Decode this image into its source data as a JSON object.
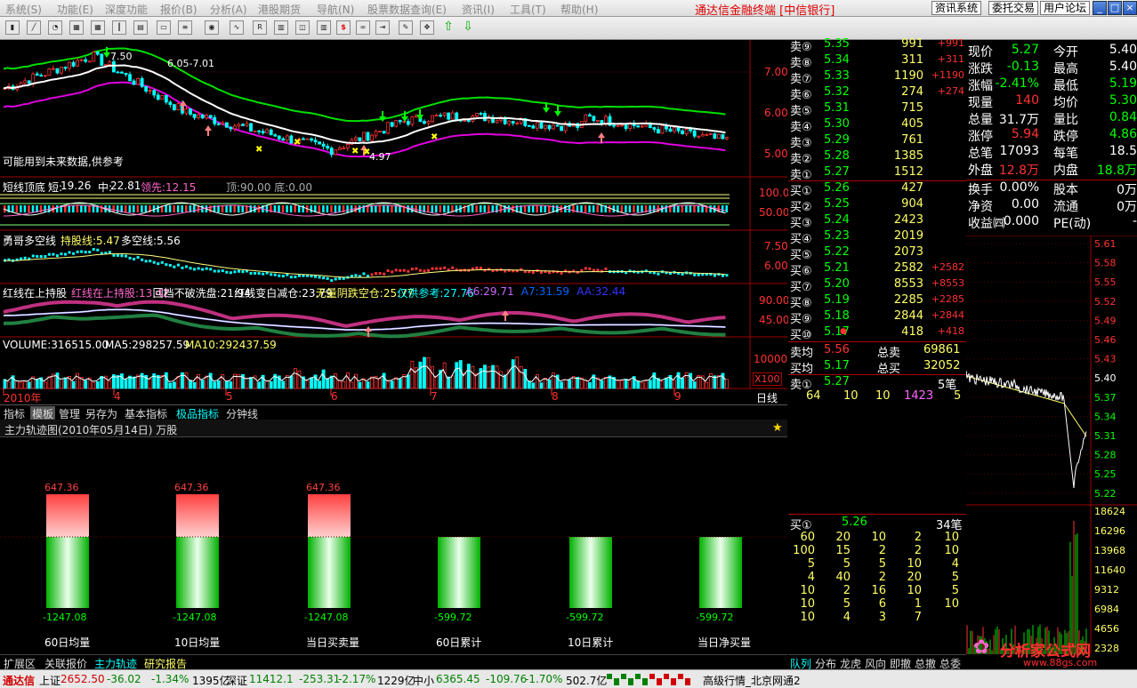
{
  "menu": [
    "系统(S)",
    "功能(E)",
    "深度功能",
    "报价(B)",
    "分析(A)",
    "港股期货",
    "导航(N)",
    "股票数据查询(E)",
    "资讯(I)",
    "工具(T)",
    "帮助(H)"
  ],
  "brand": "通达信金融终端 [中信银行]",
  "top_buttons": [
    "资讯系统",
    "委托交易",
    "用户论坛"
  ],
  "window_controls": [
    "_",
    "□",
    "×"
  ],
  "toolbar_icons": [
    "bar-chart-icon",
    "line-chart-icon",
    "pie-icon",
    "grid-icon",
    "grid-icon",
    "candle-icon",
    "table-icon",
    "doc-icon",
    "list-icon",
    "eye-icon",
    "trend-icon",
    "rsi-icon",
    "chart-icon",
    "orders-icon",
    "chart-icon",
    "dollar-icon",
    "link-icon",
    "export-icon",
    "pen-icon",
    "move-icon",
    "up-arrow-icon",
    "down-arrow-icon"
  ],
  "colors": {
    "up": "#ff3232",
    "down": "#00ffff",
    "green": "#00e000",
    "white": "#ffffff",
    "yellow": "#ffff00",
    "magenta": "#ff00ff",
    "label": "#c0c0c0"
  },
  "chart": {
    "hi_label": "7.50",
    "range_label": "6.05-7.01",
    "low_label": "4.97",
    "future_note": "可能用到未来数据,供参考",
    "price_axis": [
      "7.00",
      "6.00",
      "5.00"
    ],
    "osc_title": "短线顶底",
    "osc_params": [
      {
        "k": "短:",
        "v": "19.26"
      },
      {
        "k": "中:",
        "v": "22.81"
      }
    ],
    "osc_lead": "领先:12.15",
    "osc_extra": "顶:90.00 底:0.00",
    "osc_axis": [
      "100.0",
      "50.00"
    ],
    "bb_title": "勇哥多空线",
    "bb_hold": "持股线:5.47",
    "bb_ls": "多空线:5.56",
    "bb_axis": [
      "7.50",
      "6.00"
    ],
    "red_title": "红线在上持股",
    "red_params": [
      {
        "t": "红线在上持股:13.42",
        "c": "#ff66cc"
      },
      {
        "t": "回档不破洗盘:21.94",
        "c": "#ffffff"
      },
      {
        "t": "红线变白减仓:23.79",
        "c": "#ffffff"
      },
      {
        "t": "无量阴跌空仓:25.77",
        "c": "#ffff66"
      },
      {
        "t": "仅供参考:27.76",
        "c": "#00ffff"
      },
      {
        "t": "A6:29.71",
        "c": "#cc66ff"
      },
      {
        "t": "A7:31.59",
        "c": "#0066ff"
      },
      {
        "t": "AA:32.44",
        "c": "#3333ff"
      }
    ],
    "red_axis": [
      "90.00",
      "45.00"
    ],
    "vol_title": "VOLUME:316515.00",
    "vol_ma5": "MA5:298257.59",
    "vol_ma10": "MA10:292437.59",
    "vol_axis": [
      "10000"
    ],
    "vol_unit": "X100",
    "x_labels": [
      "2010年",
      "4",
      "5",
      "6",
      "7",
      "8",
      "9"
    ],
    "period": "日线"
  },
  "bottom_tabs": [
    "指标",
    "模板",
    "管理",
    "另存为",
    "基本指标",
    "极品指标",
    "分钟线"
  ],
  "f10": {
    "title": "主力轨迹图(2010年05月14日) 万股",
    "star_icon": "star-icon"
  },
  "bars": {
    "values": [
      647.36,
      647.36,
      647.36,
      -1247.08,
      -1247.08,
      -1247.08,
      -599.72,
      -599.72,
      -599.72
    ],
    "items": [
      {
        "label": "60日均量",
        "top": "647.36",
        "bottom": "-1247.08",
        "pos_value": 647.36,
        "neg_value": -1247.08,
        "has_red": true
      },
      {
        "label": "10日均量",
        "top": "647.36",
        "bottom": "-1247.08",
        "pos_value": 647.36,
        "neg_value": -1247.08,
        "has_red": true
      },
      {
        "label": "当日买卖量",
        "top": "647.36",
        "bottom": "-1247.08",
        "pos_value": 647.36,
        "neg_value": -1247.08,
        "has_red": true
      },
      {
        "label": "60日累计",
        "top": "",
        "bottom": "-599.72",
        "pos_value": 0,
        "neg_value": -599.72,
        "has_red": false
      },
      {
        "label": "10日累计",
        "top": "",
        "bottom": "-599.72",
        "pos_value": 0,
        "neg_value": -599.72,
        "has_red": false
      },
      {
        "label": "当日净买量",
        "top": "",
        "bottom": "-599.72",
        "pos_value": 0,
        "neg_value": -599.72,
        "has_red": false
      }
    ]
  },
  "orderbook": {
    "sells": [
      {
        "label": "卖⑨",
        "price": "5.35",
        "vol": "991",
        "chg": "+991"
      },
      {
        "label": "卖⑧",
        "price": "5.34",
        "vol": "311",
        "chg": "+311"
      },
      {
        "label": "卖⑦",
        "price": "5.33",
        "vol": "1190",
        "chg": "+1190"
      },
      {
        "label": "卖⑥",
        "price": "5.32",
        "vol": "274",
        "chg": "+274"
      },
      {
        "label": "卖⑤",
        "price": "5.31",
        "vol": "715",
        "chg": ""
      },
      {
        "label": "卖④",
        "price": "5.30",
        "vol": "405",
        "chg": ""
      },
      {
        "label": "卖③",
        "price": "5.29",
        "vol": "761",
        "chg": ""
      },
      {
        "label": "卖②",
        "price": "5.28",
        "vol": "1385",
        "chg": ""
      },
      {
        "label": "卖①",
        "price": "5.27",
        "vol": "1512",
        "chg": ""
      }
    ],
    "buys": [
      {
        "label": "买①",
        "price": "5.26",
        "vol": "427",
        "chg": ""
      },
      {
        "label": "买②",
        "price": "5.25",
        "vol": "904",
        "chg": ""
      },
      {
        "label": "买③",
        "price": "5.24",
        "vol": "2423",
        "chg": ""
      },
      {
        "label": "买④",
        "price": "5.23",
        "vol": "2019",
        "chg": ""
      },
      {
        "label": "买⑤",
        "price": "5.22",
        "vol": "2073",
        "chg": ""
      },
      {
        "label": "买⑥",
        "price": "5.21",
        "vol": "2582",
        "chg": "+2582"
      },
      {
        "label": "买⑦",
        "price": "5.20",
        "vol": "8553",
        "chg": "+8553"
      },
      {
        "label": "买⑧",
        "price": "5.19",
        "vol": "2285",
        "chg": "+2285"
      },
      {
        "label": "买⑨",
        "price": "5.18",
        "vol": "2844",
        "chg": "+2844"
      },
      {
        "label": "买⑩",
        "price": "5.17",
        "vol": "418",
        "chg": "+418"
      }
    ],
    "sell_avg_label": "卖均",
    "sell_avg": "5.56",
    "total_sell_label": "总卖",
    "total_sell": "69861",
    "buy_avg_label": "买均",
    "buy_avg": "5.17",
    "total_buy_label": "总买",
    "total_buy": "32052",
    "sell1_label": "卖①",
    "sell1_price": "5.27",
    "sell1_count": "5笔",
    "sell1_queue": [
      "64",
      "10",
      "10",
      "1423",
      "5"
    ]
  },
  "quote": {
    "rows": [
      {
        "k1": "现价",
        "v1": "5.27",
        "c1": "#00ff00",
        "k2": "今开",
        "v2": "5.40",
        "c2": "#ffffff"
      },
      {
        "k1": "涨跌",
        "v1": "-0.13",
        "c1": "#00ff00",
        "k2": "最高",
        "v2": "5.40",
        "c2": "#ffffff"
      },
      {
        "k1": "涨幅",
        "v1": "-2.41%",
        "c1": "#00ff00",
        "k2": "最低",
        "v2": "5.19",
        "c2": "#00ff00"
      },
      {
        "k1": "现量",
        "v1": "140",
        "c1": "#ff3232",
        "k2": "均价",
        "v2": "5.30",
        "c2": "#00ff00"
      },
      {
        "k1": "总量",
        "v1": "31.7万",
        "c1": "#ffffff",
        "k2": "量比",
        "v2": "0.84",
        "c2": "#00ff00"
      },
      {
        "k1": "涨停",
        "v1": "5.94",
        "c1": "#ff3232",
        "k2": "跌停",
        "v2": "4.86",
        "c2": "#00ff00"
      },
      {
        "k1": "总笔",
        "v1": "17093",
        "c1": "#ffffff",
        "k2": "每笔",
        "v2": "18.5",
        "c2": "#ffffff"
      },
      {
        "k1": "外盘",
        "v1": "12.8万",
        "c1": "#ff3232",
        "k2": "内盘",
        "v2": "18.8万",
        "c2": "#00ff00"
      }
    ],
    "rows2": [
      {
        "k1": "换手",
        "v1": "0.00%",
        "k2": "股本",
        "v2": "0万"
      },
      {
        "k1": "净资",
        "v1": "0.00",
        "k2": "流通",
        "v2": "0万"
      },
      {
        "k1": "收益㈣",
        "v1": "0.000",
        "k2": "PE(动)",
        "v2": "-"
      }
    ]
  },
  "intraday": {
    "price_ticks": [
      "5.61",
      "5.58",
      "5.55",
      "5.52",
      "5.49",
      "5.46",
      "5.43",
      "5.40",
      "5.37",
      "5.34",
      "5.31",
      "5.28",
      "5.25",
      "5.22"
    ],
    "vol_ticks": [
      "18624",
      "16296",
      "13968",
      "11640",
      "9312",
      "6984",
      "4656",
      "2328"
    ]
  },
  "deals": {
    "header_label": "买①",
    "header_price": "5.26",
    "header_count": "34笔",
    "rows": [
      [
        "60",
        "20",
        "10",
        "2",
        "10"
      ],
      [
        "100",
        "15",
        "2",
        "2",
        "10"
      ],
      [
        "5",
        "5",
        "5",
        "10",
        "4"
      ],
      [
        "4",
        "40",
        "2",
        "20",
        "5"
      ],
      [
        "10",
        "2",
        "16",
        "10",
        "5"
      ],
      [
        "10",
        "5",
        "6",
        "1",
        "10"
      ],
      [
        "10",
        "4",
        "3",
        "7",
        ""
      ]
    ]
  },
  "right_tabs": [
    "队列",
    "分布",
    "龙虎",
    "风向",
    "即撤",
    "总撤",
    "总委"
  ],
  "bottom_left_tabs": [
    "扩展区",
    "关联报价",
    "主力轨迹",
    "研究报告"
  ],
  "status": {
    "logo": "通达信",
    "sh_label": "上证",
    "sh_val": "2652.50",
    "sh_chg": "-36.02",
    "sh_pct": "-1.34%",
    "sh_amt": "1395亿",
    "sz_label": "深证",
    "sz_val": "11412.1",
    "sz_chg": "-253.31",
    "sz_pct": "-2.17%",
    "sz_amt": "1229亿",
    "zx_label": "中小",
    "zx_val": "6365.45",
    "zx_chg": "-109.76",
    "zx_pct": "-1.70%",
    "zx_amt": "502.7亿",
    "server": "高级行情_北京网通2"
  },
  "watermark": {
    "name": "分析家公式网",
    "url": "www.88gs.com"
  }
}
